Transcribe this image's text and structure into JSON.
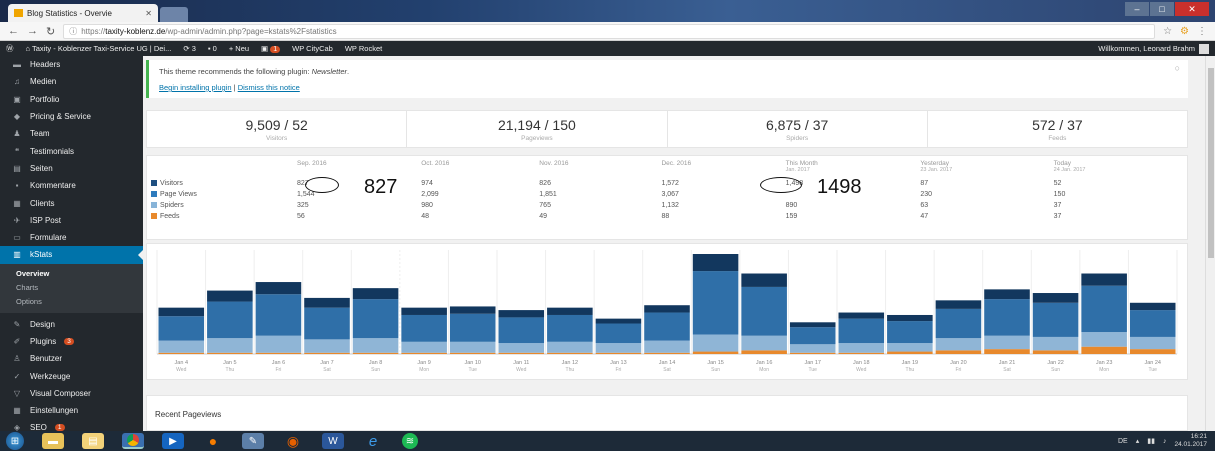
{
  "browser": {
    "tab_title": "Blog Statistics - Overvie",
    "url_prefix": "https://",
    "url_host": "taxity-koblenz.de",
    "url_path": "/wp-admin/admin.php?page=kstats%2Fstatistics"
  },
  "adminbar": {
    "site_name": "Taxity - Koblenzer Taxi-Service UG | Dei...",
    "updates_count": "3",
    "comments_count": "0",
    "new_label": "Neu",
    "plugin_badge": "1",
    "link1": "WP CityCab",
    "link2": "WP Rocket",
    "greeting": "Willkommen, Leonard Brahm"
  },
  "sidebar": {
    "items": [
      {
        "label": "Headers",
        "icon": "header-icon"
      },
      {
        "label": "Medien",
        "icon": "media-icon"
      },
      {
        "label": "Portfolio",
        "icon": "portfolio-icon"
      },
      {
        "label": "Pricing & Service",
        "icon": "tag-icon"
      },
      {
        "label": "Team",
        "icon": "team-icon"
      },
      {
        "label": "Testimonials",
        "icon": "quote-icon"
      },
      {
        "label": "Seiten",
        "icon": "pages-icon"
      },
      {
        "label": "Kommentare",
        "icon": "comments-icon"
      },
      {
        "label": "Clients",
        "icon": "clients-icon"
      },
      {
        "label": "ISP Post",
        "icon": "pin-icon"
      },
      {
        "label": "Formulare",
        "icon": "forms-icon"
      },
      {
        "label": "kStats",
        "icon": "stats-icon"
      }
    ],
    "submenu": [
      "Overview",
      "Charts",
      "Options"
    ],
    "items2": [
      {
        "label": "Design",
        "icon": "brush-icon"
      },
      {
        "label": "Plugins",
        "icon": "plugin-icon",
        "badge": "3"
      },
      {
        "label": "Benutzer",
        "icon": "users-icon"
      },
      {
        "label": "Werkzeuge",
        "icon": "tools-icon"
      },
      {
        "label": "Visual Composer",
        "icon": "vc-icon"
      },
      {
        "label": "Einstellungen",
        "icon": "settings-icon"
      },
      {
        "label": "SEO",
        "icon": "seo-icon",
        "badge": "1"
      }
    ]
  },
  "notice": {
    "text": "This theme recommends the following plugin: ",
    "plugin": "Newsletter",
    "link_install": "Begin installing plugin",
    "link_dismiss": "Dismiss this notice"
  },
  "summary": [
    {
      "value": "9,509 / 52",
      "label": "Visitors"
    },
    {
      "value": "21,194 / 150",
      "label": "Pageviews"
    },
    {
      "value": "6,875 / 37",
      "label": "Spiders"
    },
    {
      "value": "572 / 37",
      "label": "Feeds"
    }
  ],
  "stats_table": {
    "columns": [
      {
        "label": "Sep. 2016",
        "sub": ""
      },
      {
        "label": "Oct. 2016",
        "sub": ""
      },
      {
        "label": "Nov. 2016",
        "sub": ""
      },
      {
        "label": "Dec. 2016",
        "sub": ""
      },
      {
        "label": "This Month",
        "sub": "Jan. 2017"
      },
      {
        "label": "Yesterday",
        "sub": "23 Jan. 2017"
      },
      {
        "label": "Today",
        "sub": "24 Jan. 2017"
      }
    ],
    "rows": [
      {
        "label": "Visitors",
        "color": "#1e4f80",
        "values": [
          "827",
          "974",
          "826",
          "1,572",
          "1,498",
          "87",
          "52"
        ]
      },
      {
        "label": "Page Views",
        "color": "#2e7bbd",
        "values": [
          "1,544",
          "2,099",
          "1,851",
          "3,067",
          "",
          "230",
          "150"
        ]
      },
      {
        "label": "Spiders",
        "color": "#88b4d8",
        "values": [
          "325",
          "980",
          "765",
          "1,132",
          "890",
          "63",
          "37"
        ]
      },
      {
        "label": "Feeds",
        "color": "#e8892c",
        "values": [
          "56",
          "48",
          "49",
          "88",
          "159",
          "47",
          "37"
        ]
      }
    ]
  },
  "annotations": {
    "a1": "827",
    "a2": "1498"
  },
  "colors": {
    "visitors": "#12375e",
    "pageviews": "#2f6fa8",
    "spiders": "#8fb5d6",
    "feeds": "#e8892c"
  },
  "chart_data": {
    "type": "bar",
    "stacked": true,
    "categories": [
      "Jan 4",
      "Jan 5",
      "Jan 6",
      "Jan 7",
      "Jan 8",
      "Jan 9",
      "Jan 10",
      "Jan 11",
      "Jan 12",
      "Jan 13",
      "Jan 14",
      "Jan 15",
      "Jan 16",
      "Jan 17",
      "Jan 18",
      "Jan 19",
      "Jan 20",
      "Jan 21",
      "Jan 22",
      "Jan 23",
      "Jan 24"
    ],
    "weekdays": [
      "Wed",
      "Thu",
      "Fri",
      "Sat",
      "Sun",
      "Mon",
      "Tue",
      "Wed",
      "Thu",
      "Fri",
      "Sat",
      "Sun",
      "Mon",
      "Tue",
      "Wed",
      "Thu",
      "Fri",
      "Sat",
      "Sun",
      "Mon",
      "Tue"
    ],
    "series": [
      {
        "name": "Feeds",
        "values": [
          1,
          1,
          1,
          1,
          1,
          1,
          1,
          1,
          1,
          1,
          1,
          2,
          3,
          1,
          1,
          2,
          3,
          4,
          3,
          6,
          4
        ]
      },
      {
        "name": "Spiders",
        "values": [
          10,
          12,
          14,
          11,
          12,
          9,
          9,
          8,
          9,
          8,
          10,
          14,
          12,
          7,
          8,
          7,
          10,
          11,
          11,
          12,
          10
        ]
      },
      {
        "name": "Page Views",
        "values": [
          20,
          30,
          34,
          26,
          32,
          22,
          23,
          21,
          22,
          16,
          23,
          52,
          40,
          14,
          20,
          18,
          24,
          30,
          28,
          38,
          22
        ]
      },
      {
        "name": "Visitors",
        "values": [
          7,
          9,
          10,
          8,
          9,
          6,
          6,
          6,
          6,
          4,
          6,
          14,
          11,
          4,
          5,
          5,
          7,
          8,
          8,
          10,
          6
        ]
      }
    ]
  },
  "recent": {
    "title": "Recent Pageviews"
  },
  "taskbar": {
    "lang": "DE",
    "time": "16:21",
    "date": "24.01.2017"
  }
}
